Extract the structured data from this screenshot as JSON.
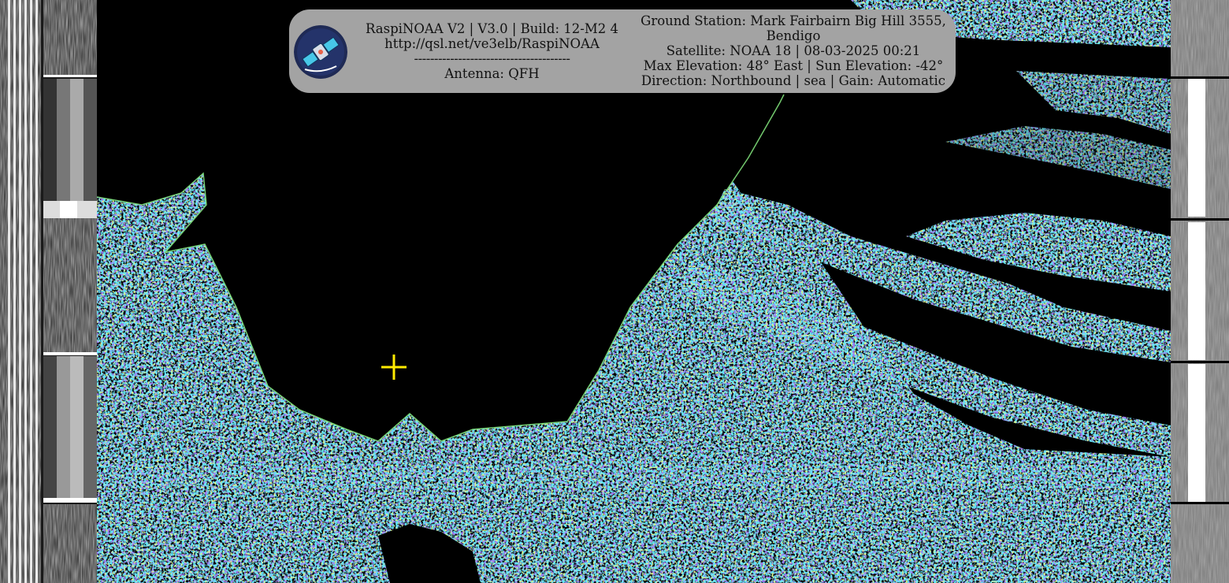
{
  "overlay": {
    "software": "RaspiNOAA V2 | V3.0 | Build: 12-M2 4",
    "url": "http://qsl.net/ve3elb/RaspiNOAA",
    "separator": "---------------------------------------",
    "antenna": "Antenna: QFH",
    "ground_station_line1": "Ground Station: Mark Fairbairn Big Hill 3555,",
    "ground_station_line2": "Bendigo",
    "satellite": "Satellite: NOAA 18 | 08-03-2025 00:21",
    "elevation": "Max Elevation: 48° East | Sun Elevation: -42°",
    "direction": "Direction: Northbound | sea | Gain: Automatic",
    "logo_icon": "satellite-icon"
  },
  "image": {
    "type": "NOAA APT false-color sea enhancement",
    "marker_icon": "crosshair-icon",
    "colors": {
      "marker": "#ffeb00",
      "background": "#000000",
      "cloud_low": "#5a2ee0",
      "cloud_mid": "#1ec8e8",
      "cloud_high": "#b6e83a"
    }
  }
}
